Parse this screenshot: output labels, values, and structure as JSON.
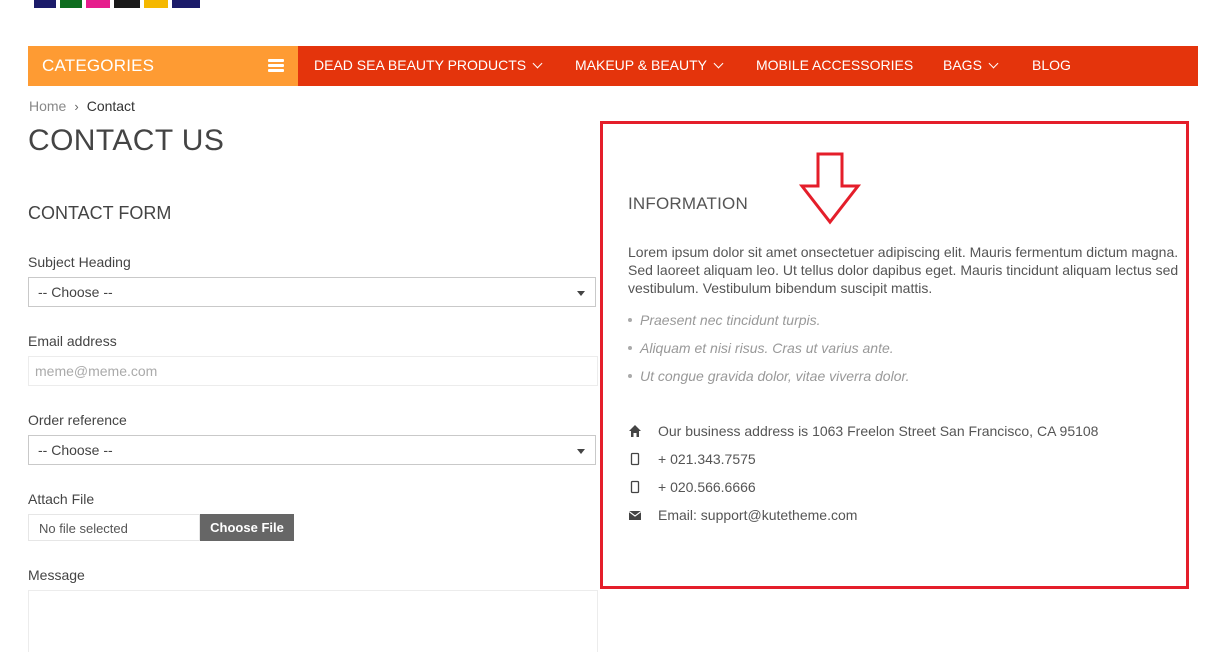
{
  "nav": {
    "categories_label": "CATEGORIES",
    "items": [
      {
        "label": "DEAD SEA BEAUTY PRODUCTS"
      },
      {
        "label": "MAKEUP & BEAUTY"
      },
      {
        "label": "MOBILE ACCESSORIES"
      },
      {
        "label": "BAGS"
      },
      {
        "label": "BLOG"
      }
    ]
  },
  "breadcrumb": {
    "home": "Home",
    "separator": "›",
    "current": "Contact"
  },
  "page_title": "CONTACT US",
  "form": {
    "title": "CONTACT FORM",
    "subject_label": "Subject Heading",
    "subject_value": "-- Choose --",
    "email_label": "Email address",
    "email_placeholder": "meme@meme.com",
    "order_label": "Order reference",
    "order_value": "-- Choose --",
    "attach_label": "Attach File",
    "file_status": "No file selected",
    "file_button": "Choose File",
    "message_label": "Message"
  },
  "info": {
    "title": "INFORMATION",
    "paragraph_lines": [
      "Lorem ipsum dolor sit amet onsectetuer adipiscing elit. Mauris fermentum dictum magna.",
      "Sed laoreet aliquam leo. Ut tellus dolor dapibus eget. Mauris tincidunt aliquam lectus sed",
      "vestibulum. Vestibulum bibendum suscipit mattis."
    ],
    "list": [
      "Praesent nec tincidunt turpis.",
      "Aliquam et nisi risus. Cras ut varius ante.",
      "Ut congue gravida dolor, vitae viverra dolor."
    ],
    "address": "Our business address is 1063 Freelon Street San Francisco, CA 95108",
    "phone1": "+ 021.343.7575",
    "phone2": "+ 020.566.6666",
    "email": "Email: support@kutetheme.com"
  },
  "icons": {
    "address": "home-icon",
    "phone": "mobile-phone-icon",
    "email": "envelope-icon",
    "annotation": "down-arrow-icon"
  },
  "colors": {
    "nav_bg": "#e4340c",
    "categories_bg": "#fe9b33",
    "annotation_red": "#e41e2a",
    "file_button_bg": "#666666"
  }
}
